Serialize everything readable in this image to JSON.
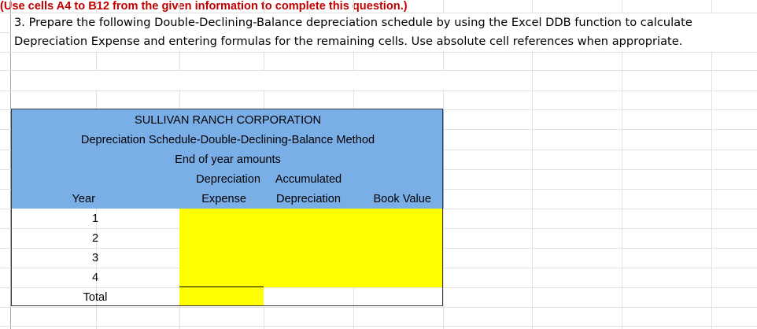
{
  "instructions": {
    "line1": "3. Prepare the following Double-Declining-Balance depreciation schedule by using the Excel DDB function to calculate",
    "line2": "Depreciation Expense and entering formulas for the remaining cells. Use absolute cell references when appropriate."
  },
  "note": "(Use cells A4 to B12 from the given information to complete this question.)",
  "table": {
    "company": "SULLIVAN RANCH CORPORATION",
    "schedule_title": "Depreciation Schedule-Double-Declining-Balance Method",
    "subtitle": "End of year amounts",
    "col_year": "Year",
    "col_dep_exp_1": "Depreciation",
    "col_dep_exp_2": "Expense",
    "col_acc_dep_1": "Accumulated",
    "col_acc_dep_2": "Depreciation",
    "col_book_value": "Book Value",
    "years": [
      "1",
      "2",
      "3",
      "4"
    ],
    "total_label": "Total"
  },
  "colors": {
    "header_fill": "#7aaee7",
    "input_fill": "#ffff00",
    "note_text": "#c00000"
  }
}
